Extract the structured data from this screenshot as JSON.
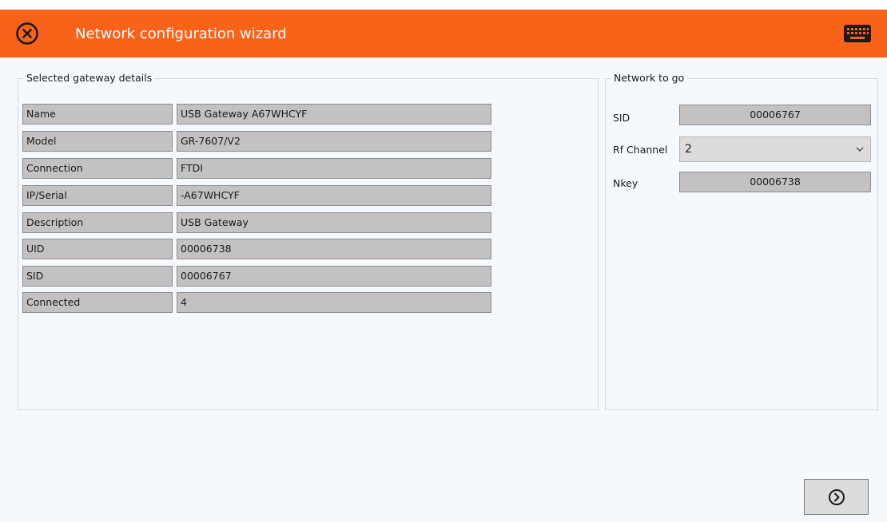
{
  "header": {
    "title": "Network configuration wizard",
    "accent_color": "#f96219",
    "close_icon": "close-circle-icon",
    "keyboard_icon": "keyboard-icon"
  },
  "gateway_details": {
    "title": "Selected gateway details",
    "rows": [
      {
        "label": "Name",
        "value": "USB Gateway A67WHCYF"
      },
      {
        "label": "Model",
        "value": "GR-7607/V2"
      },
      {
        "label": "Connection",
        "value": "FTDI"
      },
      {
        "label": "IP/Serial",
        "value": "-A67WHCYF"
      },
      {
        "label": "Description",
        "value": "USB Gateway"
      },
      {
        "label": "UID",
        "value": "00006738"
      },
      {
        "label": "SID",
        "value": "00006767"
      },
      {
        "label": "Connected",
        "value": "4"
      }
    ]
  },
  "network_to_go": {
    "title": "Network to go",
    "sid_label": "SID",
    "sid_value": "00006767",
    "rf_channel_label": "Rf Channel",
    "rf_channel_value": "2",
    "nkey_label": "Nkey",
    "nkey_value": "00006738"
  },
  "footer": {
    "next_icon": "next-arrow-circle-icon"
  }
}
